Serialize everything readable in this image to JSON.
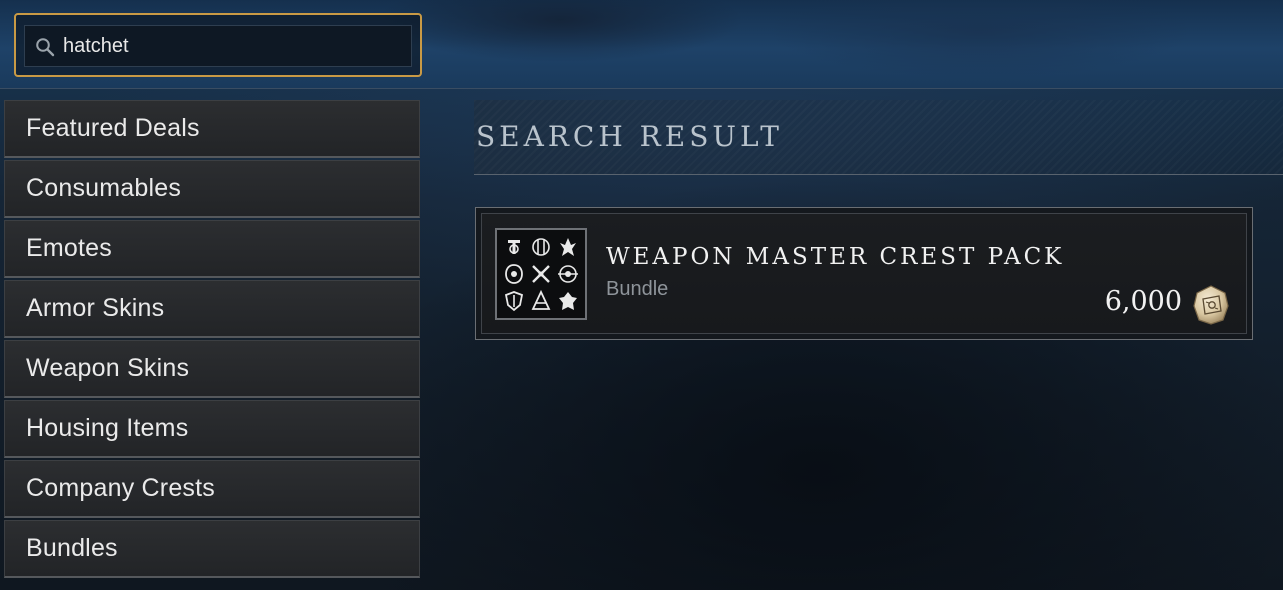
{
  "search": {
    "value": "hatchet",
    "icon": "search-icon"
  },
  "sidebar": {
    "items": [
      {
        "label": "Featured Deals"
      },
      {
        "label": "Consumables"
      },
      {
        "label": "Emotes"
      },
      {
        "label": "Armor Skins"
      },
      {
        "label": "Weapon Skins"
      },
      {
        "label": "Housing Items"
      },
      {
        "label": "Company Crests"
      },
      {
        "label": "Bundles"
      }
    ]
  },
  "main": {
    "section_title": "SEARCH RESULT",
    "results": [
      {
        "name": "WEAPON MASTER CREST PACK",
        "type": "Bundle",
        "price": "6,000",
        "currency_icon": "coin-icon",
        "thumbnail_icon": "crest-grid-icon"
      }
    ]
  },
  "colors": {
    "search_border": "#c99a45",
    "sidebar_item_bg": "#242629",
    "title_text": "#b9c3cc",
    "subtitle_text": "#8e949a"
  }
}
